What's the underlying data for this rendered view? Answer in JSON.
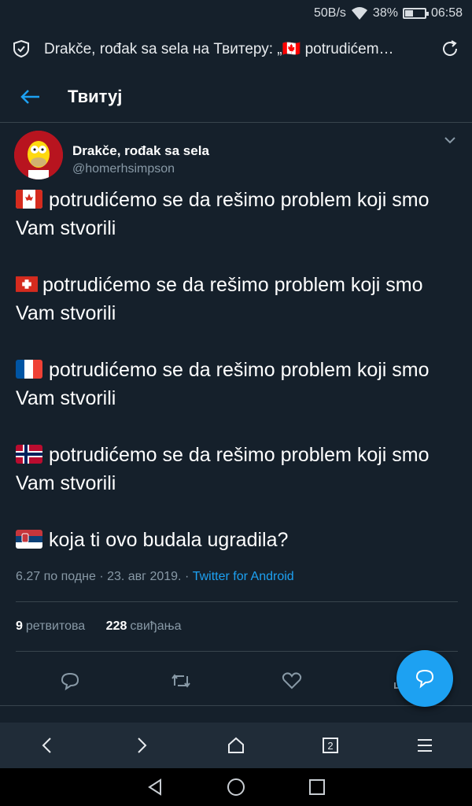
{
  "status": {
    "speed": "50B/s",
    "battery": "38%",
    "battery_level": 0.38,
    "time": "06:58"
  },
  "browser": {
    "page_title": "Drakče, rođak sa sela на Твитеру: „🇨🇦 potrudićem…",
    "tab_count": "2"
  },
  "appbar": {
    "title": "Твитуј"
  },
  "tweet": {
    "author_name": "Drakče, rođak sa sela",
    "author_handle": "@homerhsimpson",
    "paragraphs": [
      {
        "flag": "canada-flag-icon",
        "text": "potrudićemo se da rešimo problem koji smo Vam stvorili"
      },
      {
        "flag": "switzerland-flag-icon",
        "text": "potrudićemo se da rešimo problem koji smo Vam stvorili"
      },
      {
        "flag": "france-flag-icon",
        "text": "potrudićemo se da rešimo problem koji smo Vam stvorili"
      },
      {
        "flag": "norway-flag-icon",
        "text": "potrudićemo se da rešimo problem koji smo Vam stvorili"
      },
      {
        "flag": "serbia-flag-icon",
        "text": "koja ti ovo budala ugradila?"
      }
    ],
    "timestamp": "6.27 по подне · 23. авг 2019. · ",
    "source": "Twitter for Android",
    "retweets_count": "9",
    "retweets_label": "ретвитова",
    "likes_count": "228",
    "likes_label": "свиђања"
  },
  "colors": {
    "background": "#15202b",
    "accent": "#1da1f2",
    "divider": "#38444d",
    "secondary_text": "#8899a6"
  }
}
